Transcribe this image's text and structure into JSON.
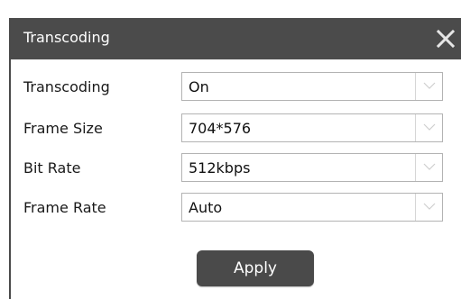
{
  "dialog": {
    "title": "Transcoding",
    "close_icon": "close-x-icon"
  },
  "form": {
    "fields": [
      {
        "label": "Transcoding",
        "value": "On"
      },
      {
        "label": "Frame Size",
        "value": "704*576"
      },
      {
        "label": "Bit Rate",
        "value": "512kbps"
      },
      {
        "label": "Frame Rate",
        "value": "Auto"
      }
    ],
    "dropdown_icon": "chevron-down-icon",
    "apply_label": "Apply"
  },
  "colors": {
    "titlebar": "#4b4b4b",
    "button": "#4a4a4a",
    "select_border": "#b3b3b3",
    "text": "#1a1a1a"
  }
}
